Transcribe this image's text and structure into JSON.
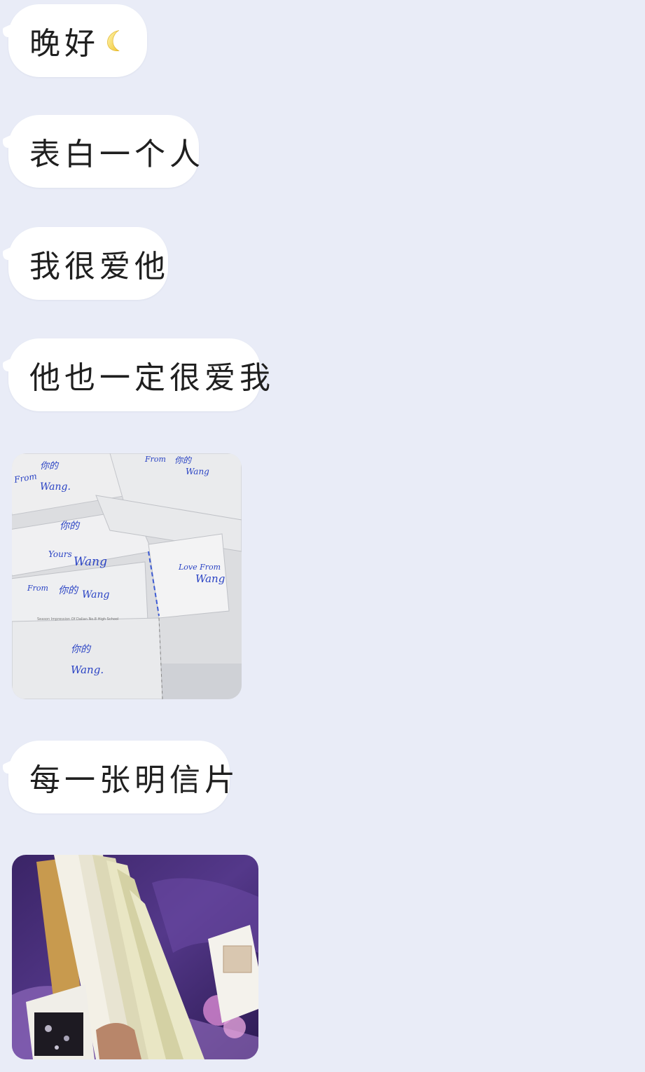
{
  "messages": [
    {
      "text": "晚好",
      "emoji": "crescent-moon-icon"
    },
    {
      "text": "表白一个人"
    },
    {
      "text": "我很爱他"
    },
    {
      "text": "他也一定很爱我"
    },
    {
      "image": "postcards-photo",
      "postcard_texts": {
        "from1": "From",
        "yours1": "你的",
        "wang1": "Wang.",
        "from2": "From",
        "yours2": "你的",
        "wang2": "Wang",
        "yours3": "你的",
        "yours_en": "Yours",
        "wang3": "Wang",
        "from3": "From",
        "yours4": "你的",
        "wang4": "Wang",
        "love_from": "Love From",
        "wang5": "Wang",
        "yours5": "你的",
        "wang6": "Wang.",
        "school_line": "Season Impression Of Dalian No.8 High School"
      }
    },
    {
      "text": "每一张明信片"
    },
    {
      "image": "postcard-stack-photo"
    }
  ]
}
